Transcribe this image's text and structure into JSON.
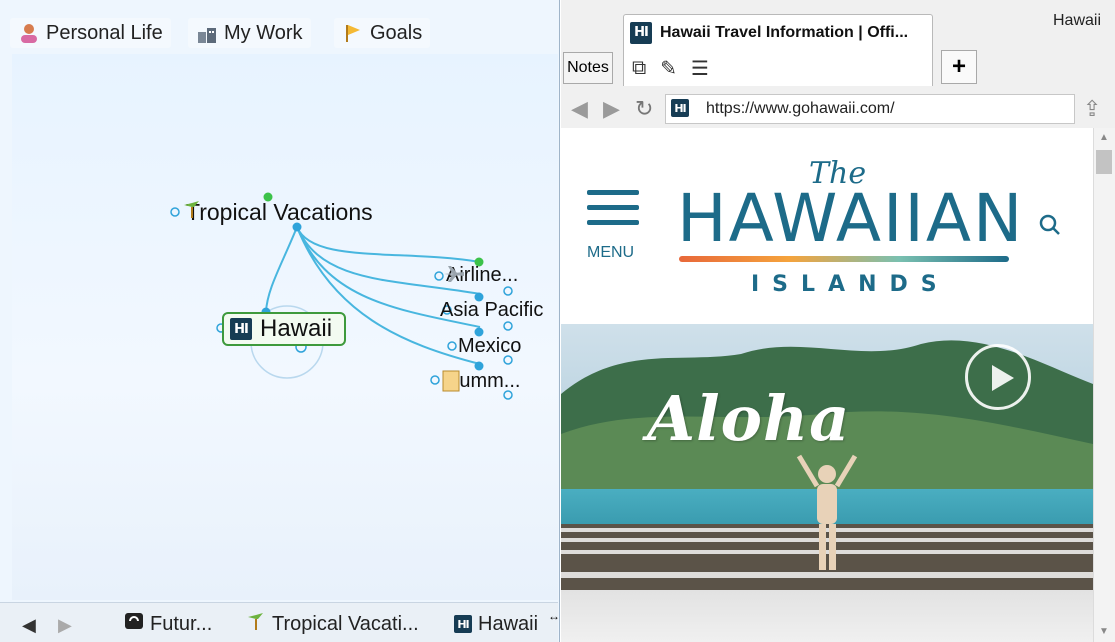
{
  "top_tabs": [
    {
      "label": "Personal Life",
      "icon": "person-icon"
    },
    {
      "label": "My Work",
      "icon": "office-icon"
    },
    {
      "label": "Goals",
      "icon": "flag-icon"
    }
  ],
  "map": {
    "central_topic": "Tropical Vacations",
    "selected_topic": "Hawaii",
    "subtopics": [
      {
        "label": "Airline...",
        "icon": "airplane-icon"
      },
      {
        "label": "Asia Pacific"
      },
      {
        "label": "Mexico"
      },
      {
        "label": "Summ...",
        "icon": "note-icon"
      }
    ]
  },
  "bottom_bar": {
    "back_icon": "left-arrow-icon",
    "forward_icon": "right-arrow-icon",
    "tabs": [
      {
        "label": "Futur...",
        "icon": "brain-icon"
      },
      {
        "label": "Tropical Vacati...",
        "icon": "palm-tree-icon"
      },
      {
        "label": "Hawaii",
        "icon": "hawaii-logo-icon"
      }
    ]
  },
  "browser": {
    "window_title": "Hawaii",
    "tab_title": "Hawaii Travel Information | Offi...",
    "notes_label": "Notes",
    "new_tab_label": "+",
    "url": "https://www.gohawaii.com/",
    "web_page": {
      "menu_label": "MENU",
      "logo_the": "The",
      "logo_main": "HAWAIIAN",
      "logo_sub": "ISLANDS",
      "hero_text": "Aloha"
    }
  },
  "colors": {
    "brand_teal": "#1d6b89",
    "connector_blue": "#48b6df",
    "selection_green": "#3e9a3c"
  }
}
